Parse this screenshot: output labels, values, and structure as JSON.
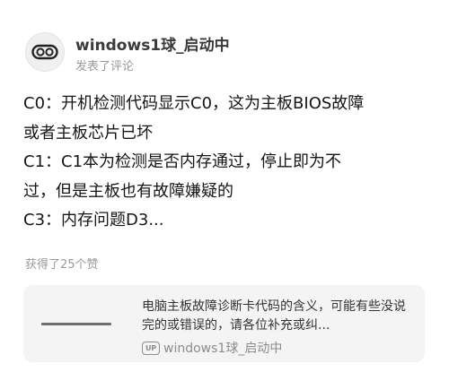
{
  "post": {
    "user_name": "windows1球_启动中",
    "action_text": "发表了评论",
    "avatar_icon": "owl-eyes-icon"
  },
  "comment": {
    "lines": [
      "C0：开机检测代码显示C0，这为主板BIOS故障",
      "或者主板芯片已坏",
      "C1：C1本为检测是否内存通过，停止即为不",
      "过，但是主板也有故障嫌疑的",
      "C3：内存问题D3..."
    ]
  },
  "likes_text": "获得了25个赞",
  "card": {
    "title": "电脑主板故障诊断卡代码的含义，可能有些没说完的或错误的，请各位补充或纠...",
    "up_badge": "UP",
    "author": "windows1球_启动中"
  },
  "colors": {
    "card_bg": "#f4f4f4",
    "secondary_text": "#9a9a9a"
  }
}
